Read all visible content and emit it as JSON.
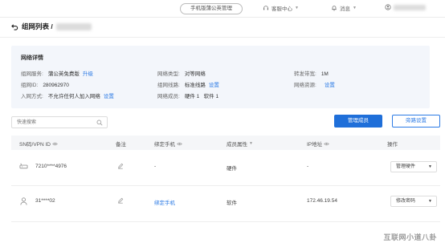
{
  "topbar": {
    "mobile_button": "手机版蒲公英管理",
    "support": "客服中心",
    "messages": "消息"
  },
  "page": {
    "title": "组网列表 /"
  },
  "network": {
    "section_title": "网络详情",
    "fields": [
      {
        "label": "组网服务:",
        "value": "蒲公英免费版",
        "link": "升级"
      },
      {
        "label": "网络类型:",
        "value": "对等网络",
        "link": ""
      },
      {
        "label": "转发带宽:",
        "value": "1M",
        "link": ""
      },
      {
        "label": "组网ID:",
        "value": "280962970",
        "link": ""
      },
      {
        "label": "组网线路:",
        "value": "标准线路",
        "link": "设置"
      },
      {
        "label": "网络资源:",
        "value": "",
        "link": "设置"
      },
      {
        "label": "入网方式:",
        "value": "不允许任何人加入网络",
        "link": "设置"
      },
      {
        "label": "网络成员:",
        "value": "硬件 1   软件 1",
        "link": ""
      }
    ]
  },
  "toolbar": {
    "search_placeholder": "快速搜索",
    "manage_members": "管理成员",
    "bypass_settings": "旁路设置"
  },
  "table": {
    "headers": {
      "sn": "SN码/VPN ID",
      "note": "备注",
      "phone": "绑定手机",
      "member_type": "成员属性",
      "ip": "IP地址",
      "action": "操作"
    },
    "rows": [
      {
        "sn": "7210****4976",
        "phone": "-",
        "type": "硬件",
        "ip": "-",
        "action": "管理硬件"
      },
      {
        "sn": "31****02",
        "phone": "绑定手机",
        "type": "软件",
        "ip": "172.46.19.54",
        "action": "修改密码"
      }
    ]
  },
  "watermark": "互联网小道八卦",
  "colors": {
    "accent": "#1f6fd9",
    "link": "#2d7be5",
    "card_bg": "#f3f6fb"
  }
}
